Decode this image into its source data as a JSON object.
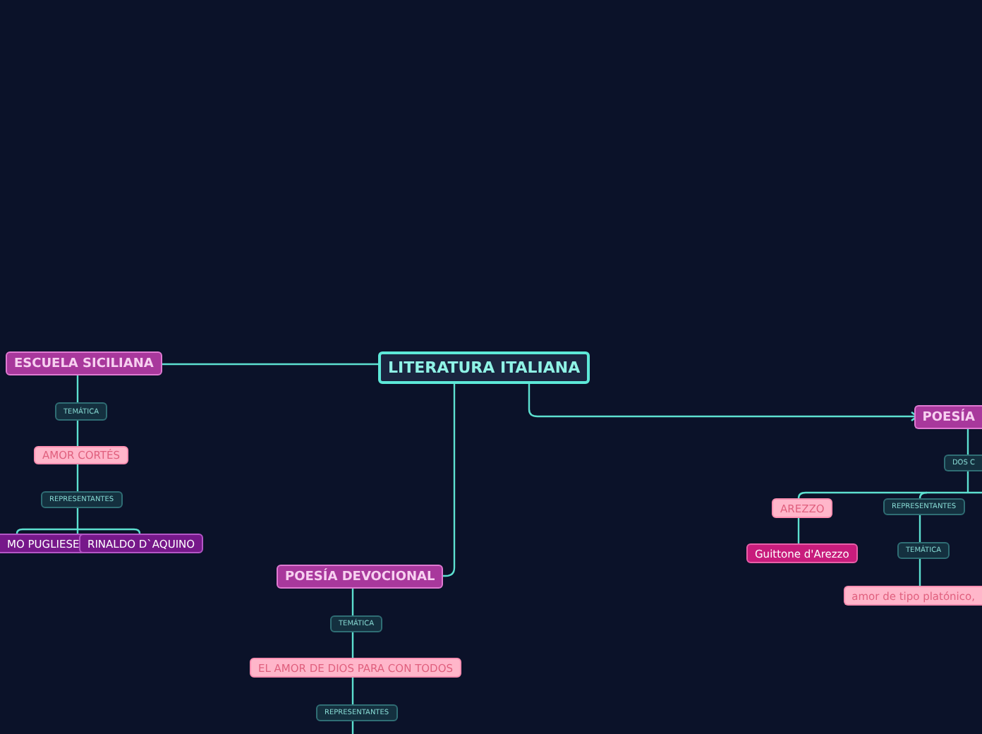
{
  "mind_map": {
    "nodes": [
      {
        "text": "LITERATURA ITALIANA",
        "kind": "root"
      },
      {
        "text": "ESCUELA SICILIANA",
        "kind": "main"
      },
      {
        "text": "TEMÁTICA",
        "kind": "label"
      },
      {
        "text": "AMOR CORTÉS",
        "kind": "pink"
      },
      {
        "text": "REPRESENTANTES",
        "kind": "label"
      },
      {
        "text": "MO PUGLIESE",
        "kind": "purple"
      },
      {
        "text": "RINALDO D`AQUINO",
        "kind": "purple"
      },
      {
        "text": "POESÍA DEVOCIONAL",
        "kind": "main"
      },
      {
        "text": "TEMÁTICA",
        "kind": "label"
      },
      {
        "text": "EL AMOR DE DIOS PARA CON TODOS",
        "kind": "pink"
      },
      {
        "text": "REPRESENTANTES",
        "kind": "label"
      },
      {
        "text": "POESÍA",
        "kind": "main"
      },
      {
        "text": "DOS C",
        "kind": "label"
      },
      {
        "text": "AREZZO",
        "kind": "pink"
      },
      {
        "text": "REPRESENTANTES",
        "kind": "label"
      },
      {
        "text": "Guittone d'Arezzo",
        "kind": "deep"
      },
      {
        "text": "TEMÁTICA",
        "kind": "label"
      },
      {
        "text": "amor de tipo platónico,",
        "kind": "pink"
      }
    ]
  }
}
